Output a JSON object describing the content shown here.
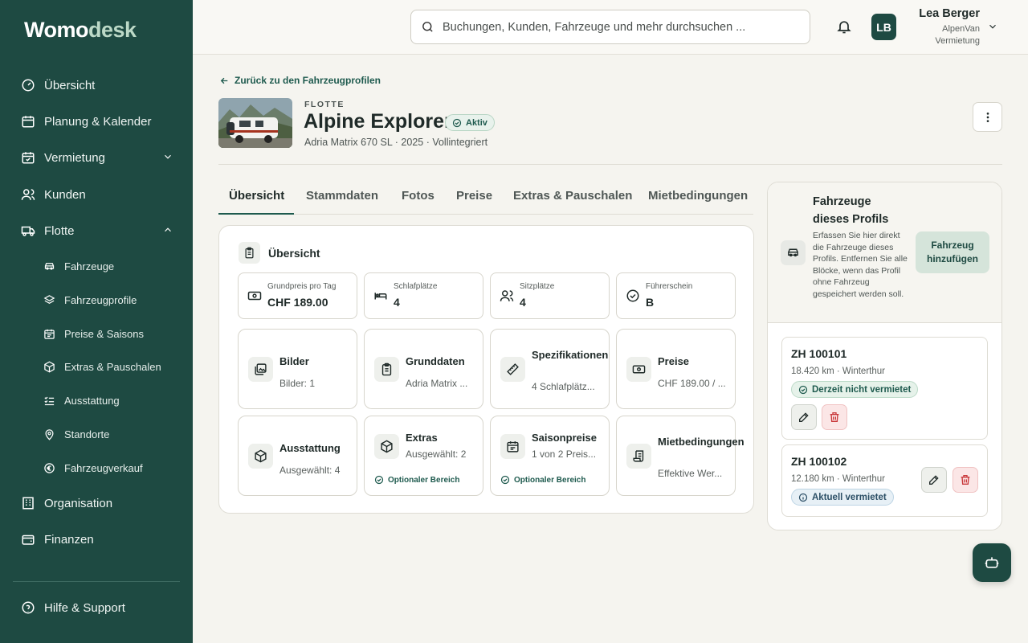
{
  "app": {
    "logo_w": "W",
    "logo_omo": "omo",
    "logo_desk": "desk"
  },
  "sidebar": {
    "items": [
      {
        "label": "Übersicht"
      },
      {
        "label": "Planung & Kalender"
      },
      {
        "label": "Vermietung"
      },
      {
        "label": "Kunden"
      },
      {
        "label": "Flotte"
      },
      {
        "label": "Organisation"
      },
      {
        "label": "Finanzen"
      }
    ],
    "subitems": [
      {
        "label": "Fahrzeuge"
      },
      {
        "label": "Fahrzeugprofile"
      },
      {
        "label": "Preise & Saisons"
      },
      {
        "label": "Extras & Pauschalen"
      },
      {
        "label": "Ausstattung"
      },
      {
        "label": "Standorte"
      },
      {
        "label": "Fahrzeugverkauf"
      }
    ],
    "help": "Hilfe & Support"
  },
  "topbar": {
    "search_placeholder": "Buchungen, Kunden, Fahrzeuge und mehr durchsuchen ...",
    "avatar_initials": "LB",
    "user_name": "Lea Berger",
    "user_org": "AlpenVan Vermietung"
  },
  "header": {
    "back_link": "Zurück zu den Fahrzeugprofilen",
    "eyebrow": "FLOTTE",
    "title": "Alpine Explorer",
    "status": "Aktiv",
    "subtitle": "Adria Matrix 670 SL · 2025 · Vollintegriert"
  },
  "tabs": [
    {
      "label": "Übersicht"
    },
    {
      "label": "Stammdaten"
    },
    {
      "label": "Fotos"
    },
    {
      "label": "Preise"
    },
    {
      "label": "Extras & Pauschalen"
    },
    {
      "label": "Mietbedingungen"
    }
  ],
  "overview": {
    "title": "Übersicht",
    "stats": [
      {
        "label": "Grundpreis pro Tag",
        "value": "CHF 189.00"
      },
      {
        "label": "Schlafplätze",
        "value": "4"
      },
      {
        "label": "Sitzplätze",
        "value": "4"
      },
      {
        "label": "Führerschein",
        "value": "B"
      }
    ],
    "tiles": [
      {
        "title": "Bilder",
        "sub": "Bilder: 1"
      },
      {
        "title": "Grunddaten",
        "sub": "Adria Matrix ..."
      },
      {
        "title": "Spezifikationen",
        "sub": "4 Schlafplätz..."
      },
      {
        "title": "Preise",
        "sub": "CHF 189.00 / ..."
      },
      {
        "title": "Ausstattung",
        "sub": "Ausgewählt: 4"
      },
      {
        "title": "Extras",
        "sub": "Ausgewählt: 2",
        "optional": "Optionaler Bereich"
      },
      {
        "title": "Saisonpreise",
        "sub": "1 von 2 Preis...",
        "optional": "Optionaler Bereich"
      },
      {
        "title": "Mietbedingungen",
        "sub": "Effektive Wer..."
      }
    ]
  },
  "vehicles_panel": {
    "title": "Fahrzeuge dieses Profils",
    "description": "Erfassen Sie hier direkt die Fahrzeuge dieses Profils. Entfernen Sie alle Blöcke, wenn das Profil ohne Fahrzeug gespeichert werden soll.",
    "add_button": "Fahrzeug hinzufügen",
    "vehicles": [
      {
        "plate": "ZH 100101",
        "meta": "18.420 km · Winterthur",
        "status": "Derzeit nicht vermietet"
      },
      {
        "plate": "ZH 100102",
        "meta": "12.180 km · Winterthur",
        "status": "Aktuell vermietet"
      }
    ]
  },
  "colors": {
    "sidebar_bg": "#1e4a42",
    "accent": "#1e5a4e",
    "page_bg": "#f5f4ef"
  }
}
